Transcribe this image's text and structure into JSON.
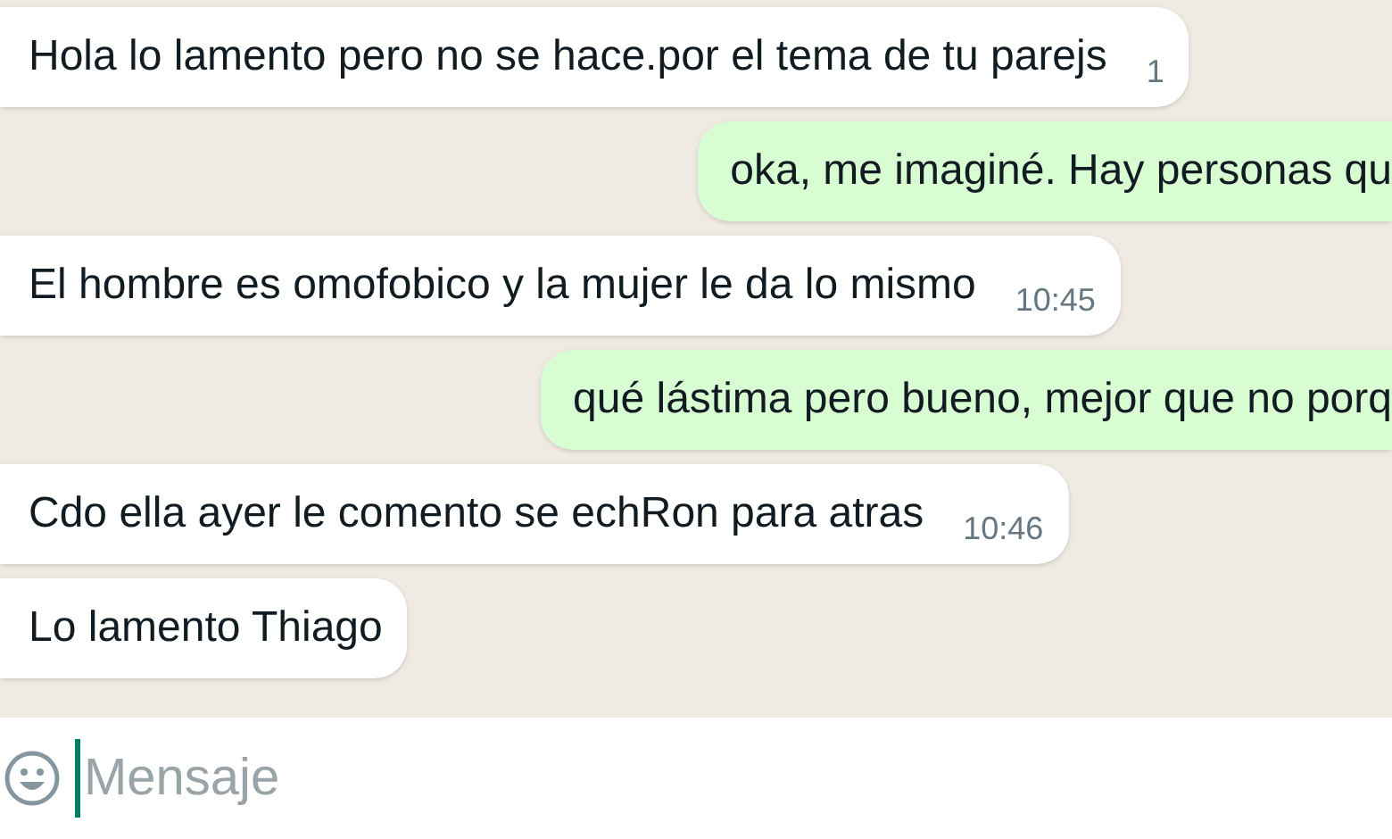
{
  "messages": [
    {
      "kind": "incoming",
      "text": "Hola lo lamento pero no se hace.por el tema de tu parejs",
      "time": "1"
    },
    {
      "kind": "outgoing",
      "text": "oka, me imaginé. Hay personas qu"
    },
    {
      "kind": "incoming",
      "text": "El hombre es omofobico y la mujer le da lo mismo",
      "time": "10:45"
    },
    {
      "kind": "outgoing",
      "text": "qué lástima pero bueno, mejor que no porq"
    },
    {
      "kind": "incoming",
      "text": "Cdo ella ayer le comento se echRon para atras",
      "time": "10:46"
    },
    {
      "kind": "incoming",
      "text": "Lo lamento Thiago"
    }
  ],
  "composer": {
    "placeholder": "Mensaje"
  }
}
